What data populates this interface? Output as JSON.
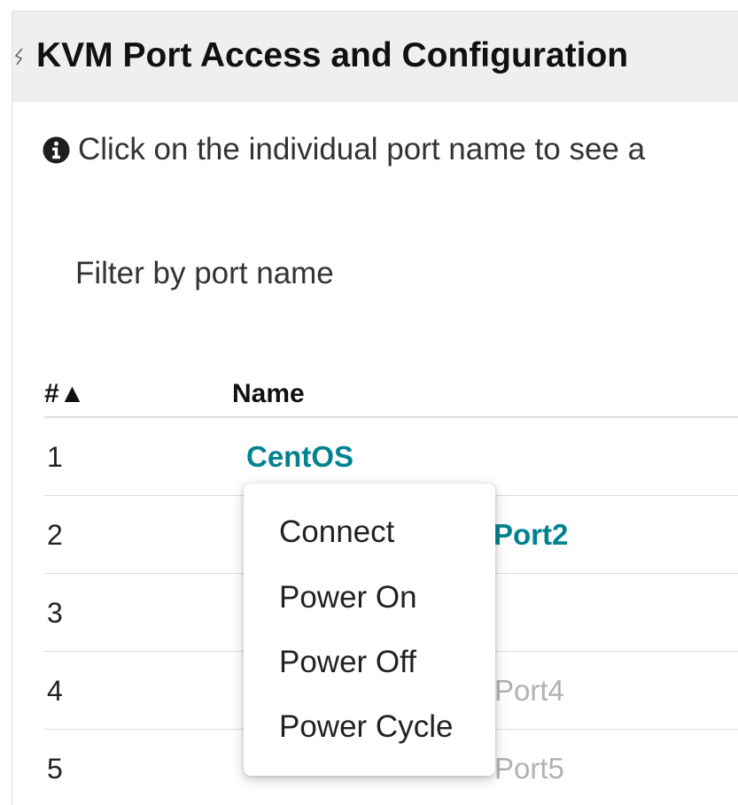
{
  "header": {
    "title": "KVM Port Access and Configuration"
  },
  "info": {
    "icon": "info-circle-icon",
    "text": "Click on the individual port name to see a"
  },
  "filter": {
    "placeholder": "Filter by port name",
    "value": ""
  },
  "table": {
    "columns": [
      {
        "label": "#▲",
        "sort": "ascending"
      },
      {
        "label": "Name"
      }
    ],
    "rows": [
      {
        "num": "1",
        "name": "CentOS",
        "state": "active"
      },
      {
        "num": "2",
        "name": "Port2",
        "state": "active",
        "partially_covered": true
      },
      {
        "num": "3",
        "name": "",
        "state": "covered"
      },
      {
        "num": "4",
        "name": "Port4",
        "state": "muted",
        "partially_covered": true
      },
      {
        "num": "5",
        "name": "Port5",
        "state": "muted",
        "partially_covered": true
      }
    ]
  },
  "context_menu": {
    "items": [
      {
        "label": "Connect"
      },
      {
        "label": "Power On"
      },
      {
        "label": "Power Off"
      },
      {
        "label": "Power Cycle"
      }
    ]
  },
  "colors": {
    "header_bg": "#efefef",
    "link": "#00838f",
    "muted_link": "#b2b2b2",
    "divider": "#dcdcdc"
  }
}
